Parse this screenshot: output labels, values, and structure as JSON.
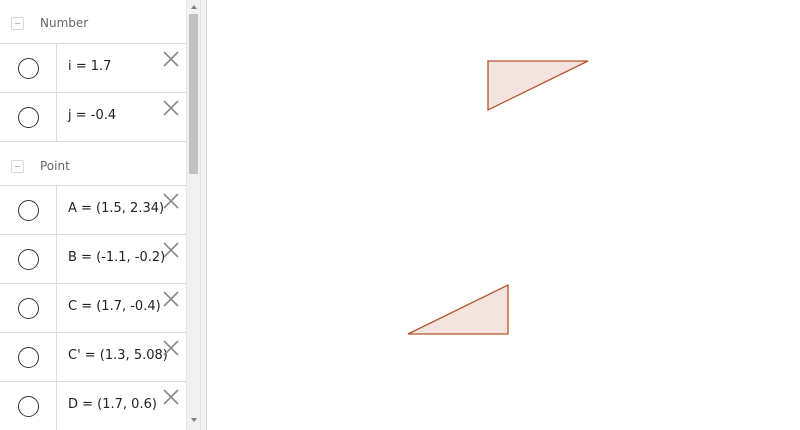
{
  "algebra": {
    "groups": [
      {
        "label": "Number",
        "items": [
          {
            "text": "i = 1.7"
          },
          {
            "text": "j = -0.4"
          }
        ]
      },
      {
        "label": "Point",
        "items": [
          {
            "text": "A = (1.5, 2.34)"
          },
          {
            "text": "B = (-1.1, -0.2)"
          },
          {
            "text": "C = (1.7, -0.4)"
          },
          {
            "text": "C' = (1.3, 5.08)"
          },
          {
            "text": "D = (1.7, 0.6)"
          }
        ]
      }
    ]
  },
  "graphics": {
    "polygon_fill": "#f3e4df",
    "polygon_stroke": "#b5532a"
  }
}
